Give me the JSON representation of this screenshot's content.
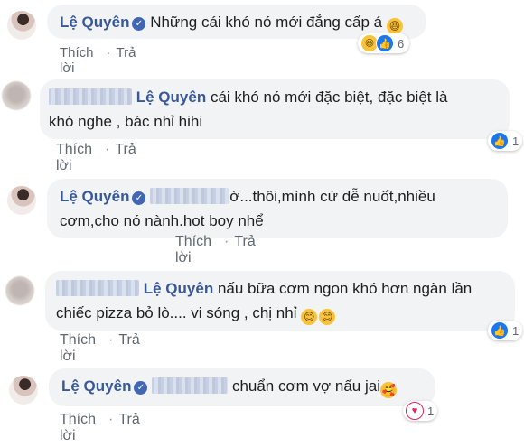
{
  "actions": {
    "like": "Thích",
    "reply": "Trả lời"
  },
  "comments": [
    {
      "author": "Lệ Quyên",
      "verified": true,
      "text": "Những cái khó nó mới đẳng cấp á",
      "emoji": "grinning-squint",
      "reactions": [
        "haha",
        "like"
      ],
      "reaction_count": "6"
    },
    {
      "author": "Lệ Quyên",
      "tagged": "",
      "line1": "cái khó nó mới đặc biệt, đặc biệt là",
      "line2": "khó nghe , bác nhỉ hihi",
      "reactions": [
        "like"
      ],
      "reaction_count": "1"
    },
    {
      "author": "Lệ Quyên",
      "verified": true,
      "line1": "ờ...thôi,mình cứ dễ nuốt,nhiều",
      "line2": "cơm,cho nó nành.hot boy nhể"
    },
    {
      "author": "Lệ Quyên",
      "line1": "nấu bữa cơm ngon khó hơn ngàn lần",
      "line2": "chiếc pizza bỏ lò.... vi sóng , chị nhỉ",
      "emojis": [
        "smiling",
        "smiling"
      ],
      "reactions": [
        "like"
      ],
      "reaction_count": "1"
    },
    {
      "author": "Lệ Quyên",
      "verified": true,
      "text": "chuẩn cơm vợ nấu jai",
      "emoji": "hearts-face",
      "reactions": [
        "love"
      ],
      "reaction_count": "1"
    }
  ],
  "colors": {
    "name": "#385898",
    "bubble": "#f2f3f5",
    "like": "#1877f2",
    "love": "#e0245e"
  }
}
